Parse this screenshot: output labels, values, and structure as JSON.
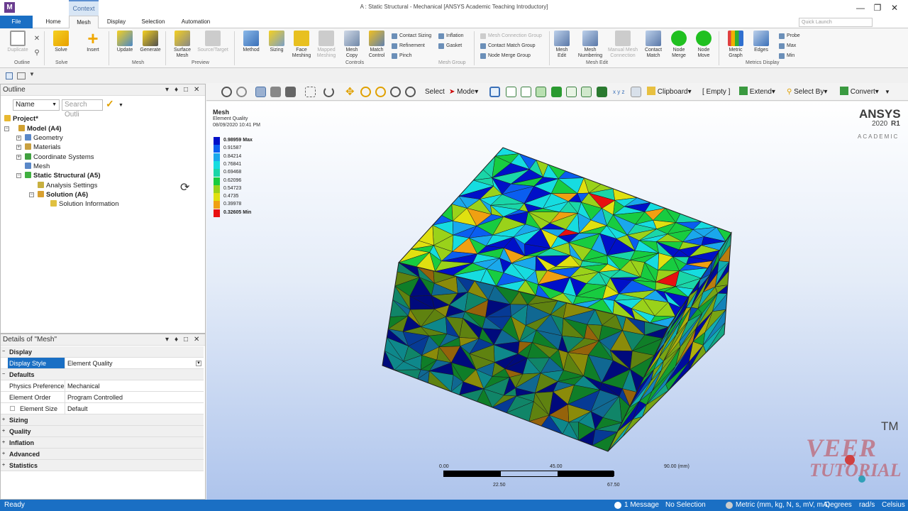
{
  "titlebar": {
    "context_tab": "Context",
    "title": "A : Static Structural - Mechanical [ANSYS Academic Teaching Introductory]",
    "logo_letter": "M"
  },
  "tabs": [
    "File",
    "Home",
    "Mesh",
    "Display",
    "Selection",
    "Automation"
  ],
  "quick_launch": {
    "placeholder": "Quick Launch"
  },
  "ribbon": {
    "outline_group": {
      "duplicate": "Duplicate",
      "label": "Outline"
    },
    "solve_group": {
      "solve": "Solve",
      "insert": "Insert",
      "label": "Solve"
    },
    "mesh_group": {
      "update": "Update",
      "generate": "Generate",
      "label": "Mesh"
    },
    "preview_group": {
      "surface_mesh": [
        "Surface",
        "Mesh"
      ],
      "source_target": "Source/Target",
      "label": "Preview"
    },
    "controls_group": {
      "method": "Method",
      "sizing": "Sizing",
      "face_meshing": [
        "Face",
        "Meshing"
      ],
      "mapped_meshing": [
        "Mapped",
        "Meshing"
      ],
      "mesh_copy": [
        "Mesh",
        "Copy"
      ],
      "match_control": [
        "Match",
        "Control"
      ],
      "contact_sizing": "Contact Sizing",
      "refinement": "Refinement",
      "pinch": "Pinch",
      "inflation": "Inflation",
      "gasket": "Gasket",
      "label": "Controls"
    },
    "mesh_group_group": {
      "connection": "Mesh Connection Group",
      "contact_match": "Contact Match Group",
      "node_merge": "Node Merge Group",
      "label": "Mesh Group"
    },
    "mesh_edit_group": {
      "mesh_edit": [
        "Mesh",
        "Edit"
      ],
      "mesh_numbering": [
        "Mesh",
        "Numbering"
      ],
      "manual_mesh": [
        "Manual Mesh",
        "Connection"
      ],
      "contact_match": [
        "Contact",
        "Match"
      ],
      "node_merge": [
        "Node",
        "Merge"
      ],
      "node_move": [
        "Node",
        "Move"
      ],
      "label": "Mesh Edit"
    },
    "metrics_group": {
      "metric_graph": [
        "Metric",
        "Graph"
      ],
      "edges": "Edges",
      "probe": "Probe",
      "max": "Max",
      "min": "Min",
      "label": "Metrics Display"
    }
  },
  "outline": {
    "title": "Outline",
    "filter_label": "Name",
    "search_placeholder": "Search Outli",
    "tree": [
      "Project*",
      "Model (A4)",
      "Geometry",
      "Materials",
      "Coordinate Systems",
      "Mesh",
      "Static Structural (A5)",
      "Analysis Settings",
      "Solution (A6)",
      "Solution Information"
    ]
  },
  "details": {
    "title": "Details of \"Mesh\"",
    "groups": {
      "display": "Display",
      "defaults": "Defaults",
      "sizing": "Sizing",
      "quality": "Quality",
      "inflation": "Inflation",
      "advanced": "Advanced",
      "statistics": "Statistics"
    },
    "rows": [
      {
        "k": "Display Style",
        "v": "Element Quality"
      },
      {
        "k": "Physics Preference",
        "v": "Mechanical"
      },
      {
        "k": "Element Order",
        "v": "Program Controlled"
      },
      {
        "k": "Element Size",
        "v": "Default"
      }
    ]
  },
  "viewtools": {
    "select": "Select",
    "mode": "Mode",
    "clipboard": "Clipboard",
    "empty": "[ Empty ]",
    "extend": "Extend",
    "select_by": "Select By",
    "convert": "Convert"
  },
  "viewport": {
    "title": "Mesh",
    "subtitle": "Element Quality",
    "date": "08/09/2020 10:41 PM",
    "brand": "ANSYS",
    "version_year": "2020",
    "version_rel": "R1",
    "edition": "ACADEMIC",
    "legend": [
      {
        "v": "0.98959 Max",
        "c": "#0010c8"
      },
      {
        "v": "0.91587",
        "c": "#0a5ef0"
      },
      {
        "v": "0.84214",
        "c": "#1aa8ec"
      },
      {
        "v": "0.76841",
        "c": "#16dce0"
      },
      {
        "v": "0.69468",
        "c": "#1ad6a8"
      },
      {
        "v": "0.62096",
        "c": "#18cc40"
      },
      {
        "v": "0.54723",
        "c": "#9ad21a"
      },
      {
        "v": "0.4735",
        "c": "#e0e010"
      },
      {
        "v": "0.39978",
        "c": "#f0a012"
      },
      {
        "v": "0.32605 Min",
        "c": "#e81010"
      }
    ],
    "scale": {
      "t0": "0.00",
      "t1": "45.00",
      "t2": "90.00 (mm)",
      "b1": "22.50",
      "b2": "67.50"
    },
    "watermark": {
      "tm": "TM",
      "line1": "VEER",
      "line2": "TUTORIAL"
    }
  },
  "status": {
    "ready": "Ready",
    "messages": "1 Message",
    "selection": "No Selection",
    "units": "Metric (mm, kg, N, s, mV, mA)",
    "angle": "Degrees",
    "rot": "rad/s",
    "temp": "Celsius"
  }
}
